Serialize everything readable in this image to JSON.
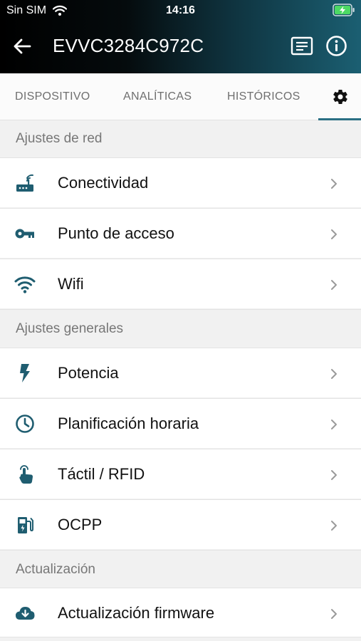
{
  "status_bar": {
    "carrier": "Sin SIM",
    "time": "14:16"
  },
  "header": {
    "title": "EVVC3284C972C"
  },
  "tabs": [
    {
      "label": "DISPOSITIVO"
    },
    {
      "label": "ANALÍTICAS"
    },
    {
      "label": "HISTÓRICOS"
    },
    {
      "icon": "gear-icon",
      "selected": true
    }
  ],
  "sections": [
    {
      "title": "Ajustes de red",
      "items": [
        {
          "label": "Conectividad",
          "icon": "router-icon"
        },
        {
          "label": "Punto de acceso",
          "icon": "key-icon"
        },
        {
          "label": "Wifi",
          "icon": "wifi-icon"
        }
      ]
    },
    {
      "title": "Ajustes generales",
      "items": [
        {
          "label": "Potencia",
          "icon": "lightning-icon"
        },
        {
          "label": "Planificación horaria",
          "icon": "clock-icon"
        },
        {
          "label": "Táctil / RFID",
          "icon": "touch-icon"
        },
        {
          "label": "OCPP",
          "icon": "charging-station-icon"
        }
      ]
    },
    {
      "title": "Actualización",
      "items": [
        {
          "label": "Actualización firmware",
          "icon": "cloud-download-icon"
        }
      ]
    }
  ],
  "colors": {
    "icon": "#1f5d70",
    "accent": "#2a6f83",
    "battery": "#4cd964"
  }
}
